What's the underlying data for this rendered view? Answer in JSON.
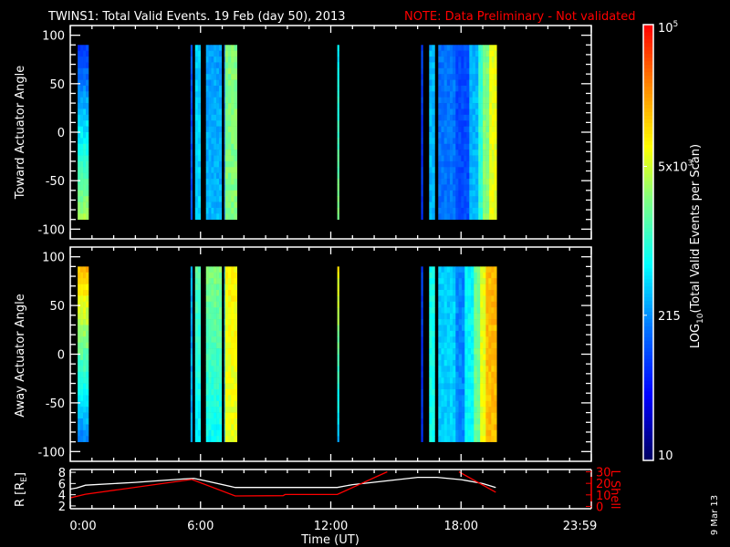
{
  "title": "TWINS1: Total Valid Events. 19 Feb (day  50), 2013",
  "note": "NOTE: Data Preliminary - Not validated",
  "date_stamp": "9 Mar 13",
  "colors": {
    "background": "#000000",
    "axes": "#ffffff",
    "note": "#ff0000",
    "l_shell": "#ff0000",
    "r_trace": "#ffffff"
  },
  "chart_data": {
    "type": "heatmap",
    "x": {
      "label": "Time (UT)",
      "range_hours": [
        0,
        24
      ],
      "ticks": [
        {
          "hour": 0,
          "label": "0:00"
        },
        {
          "hour": 6,
          "label": "6:00"
        },
        {
          "hour": 12,
          "label": "12:00"
        },
        {
          "hour": 18,
          "label": "18:00"
        },
        {
          "hour": 23.98,
          "label": "23:59"
        }
      ]
    },
    "panels": [
      {
        "ylabel": "Toward Actuator Angle",
        "ylim": [
          -110,
          110
        ],
        "yticks": [
          {
            "v": 100,
            "label": "100"
          },
          {
            "v": 50,
            "label": "50"
          },
          {
            "v": 0,
            "label": "0"
          },
          {
            "v": -50,
            "label": "-50"
          },
          {
            "v": -100,
            "label": "-100"
          }
        ],
        "angle_range": [
          -90,
          90
        ],
        "columns": [
          {
            "t": [
              0.34,
              0.84
            ],
            "top": 1.9,
            "bottom": 3.6
          },
          {
            "t": [
              5.54,
              5.62
            ],
            "top": 2.0,
            "bottom": 2.0
          },
          {
            "t": [
              5.75,
              6.0
            ],
            "top": 2.6,
            "bottom": 2.6
          },
          {
            "t": [
              6.25,
              6.97
            ],
            "top": 2.4,
            "bottom": 2.5
          },
          {
            "t": [
              7.09,
              7.13
            ],
            "top": 2.2,
            "bottom": 2.2
          },
          {
            "t": [
              7.13,
              7.68
            ],
            "top": 3.4,
            "bottom": 3.4
          },
          {
            "t": [
              12.3,
              12.38
            ],
            "top": 2.7,
            "bottom": 3.5
          },
          {
            "t": [
              16.16,
              16.24
            ],
            "top": 1.9,
            "bottom": 1.9
          },
          {
            "t": [
              16.53,
              16.79
            ],
            "top": 2.5,
            "bottom": 2.5
          },
          {
            "t": [
              16.95,
              17.75
            ],
            "top": 2.2,
            "bottom": 2.2
          },
          {
            "t": [
              17.75,
              18.38
            ],
            "top": 2.0,
            "bottom": 2.0
          },
          {
            "t": [
              18.38,
              18.8
            ],
            "top": 2.5,
            "bottom": 2.5
          },
          {
            "t": [
              18.8,
              19.0
            ],
            "top": 3.0,
            "bottom": 3.0
          },
          {
            "t": [
              19.0,
              19.3
            ],
            "top": 3.4,
            "bottom": 3.4
          },
          {
            "t": [
              19.3,
              19.64
            ],
            "top": 3.8,
            "bottom": 3.8
          }
        ]
      },
      {
        "ylabel": "Away Actuator Angle",
        "ylim": [
          -110,
          110
        ],
        "yticks": [
          {
            "v": 100,
            "label": "100"
          },
          {
            "v": 50,
            "label": "50"
          },
          {
            "v": 0,
            "label": "0"
          },
          {
            "v": -50,
            "label": "-50"
          },
          {
            "v": -100,
            "label": "-100"
          }
        ],
        "angle_range": [
          -90,
          90
        ],
        "columns": [
          {
            "t": [
              0.34,
              0.84
            ],
            "top": 4.2,
            "bottom": 2.2
          },
          {
            "t": [
              5.54,
              5.62
            ],
            "top": 2.4,
            "bottom": 2.4
          },
          {
            "t": [
              5.75,
              6.0
            ],
            "top": 3.2,
            "bottom": 2.7
          },
          {
            "t": [
              6.25,
              6.97
            ],
            "top": 3.4,
            "bottom": 2.8
          },
          {
            "t": [
              7.09,
              7.13
            ],
            "top": 2.5,
            "bottom": 2.5
          },
          {
            "t": [
              7.13,
              7.68
            ],
            "top": 3.9,
            "bottom": 3.8
          },
          {
            "t": [
              12.3,
              12.38
            ],
            "top": 3.9,
            "bottom": 2.5
          },
          {
            "t": [
              16.16,
              16.24
            ],
            "top": 1.9,
            "bottom": 1.9
          },
          {
            "t": [
              16.53,
              16.79
            ],
            "top": 2.9,
            "bottom": 2.9
          },
          {
            "t": [
              16.95,
              17.75
            ],
            "top": 2.6,
            "bottom": 2.6
          },
          {
            "t": [
              17.75,
              18.17
            ],
            "top": 2.3,
            "bottom": 2.3
          },
          {
            "t": [
              18.17,
              18.59
            ],
            "top": 2.8,
            "bottom": 2.8
          },
          {
            "t": [
              18.59,
              18.88
            ],
            "top": 3.3,
            "bottom": 3.3
          },
          {
            "t": [
              18.88,
              19.14
            ],
            "top": 3.8,
            "bottom": 3.8
          },
          {
            "t": [
              19.14,
              19.64
            ],
            "top": 4.2,
            "bottom": 4.2
          }
        ]
      }
    ],
    "colorbar": {
      "label_main": "LOG",
      "label_sub": "10",
      "label_rest": "(Total Valid Events per Scan)",
      "range_log10": [
        1,
        5
      ],
      "ticks": [
        {
          "log10": 5,
          "text": "10",
          "sup": "5"
        },
        {
          "log10": 3.699,
          "text": "5x10",
          "sup": "3"
        },
        {
          "log10": 2.332,
          "text": "215",
          "sup": ""
        },
        {
          "log10": 1,
          "text": "10",
          "sup": ""
        }
      ]
    },
    "line_panel": {
      "left_label_main": "R [R",
      "left_label_sub": "E",
      "left_label_end": "]",
      "right_label": "L Shell",
      "r_ylim": [
        1.5,
        8.5
      ],
      "l_ylim": [
        -2,
        32
      ],
      "r_ticks": [
        {
          "v": 8,
          "label": "8"
        },
        {
          "v": 6,
          "label": "6"
        },
        {
          "v": 4,
          "label": "4"
        },
        {
          "v": 2,
          "label": "2"
        }
      ],
      "l_ticks": [
        {
          "v": 30,
          "label": "30"
        },
        {
          "v": 20,
          "label": "20"
        },
        {
          "v": 10,
          "label": "10"
        },
        {
          "v": 0,
          "label": "0"
        }
      ],
      "r_series": [
        [
          0,
          5.0
        ],
        [
          0.3,
          5.2
        ],
        [
          0.7,
          5.7
        ],
        [
          3,
          6.2
        ],
        [
          5.2,
          6.8
        ],
        [
          5.7,
          6.9
        ],
        [
          6.2,
          6.5
        ],
        [
          7.6,
          5.3
        ],
        [
          12.3,
          5.3
        ],
        [
          13,
          5.8
        ],
        [
          16,
          7.1
        ],
        [
          16.9,
          7.1
        ],
        [
          18,
          6.7
        ],
        [
          19,
          6.0
        ],
        [
          19.6,
          5.3
        ]
      ],
      "l_series": [
        [
          [
            0,
            7.4
          ],
          [
            0.7,
            10.6
          ],
          [
            5.6,
            23.4
          ],
          [
            7.6,
            9.1
          ],
          [
            9.8,
            9.3
          ],
          [
            9.9,
            10.3
          ],
          [
            12.3,
            10.3
          ],
          [
            14.6,
            30
          ]
        ],
        [
          [
            17.9,
            30
          ],
          [
            19.6,
            12.3
          ]
        ]
      ]
    }
  }
}
